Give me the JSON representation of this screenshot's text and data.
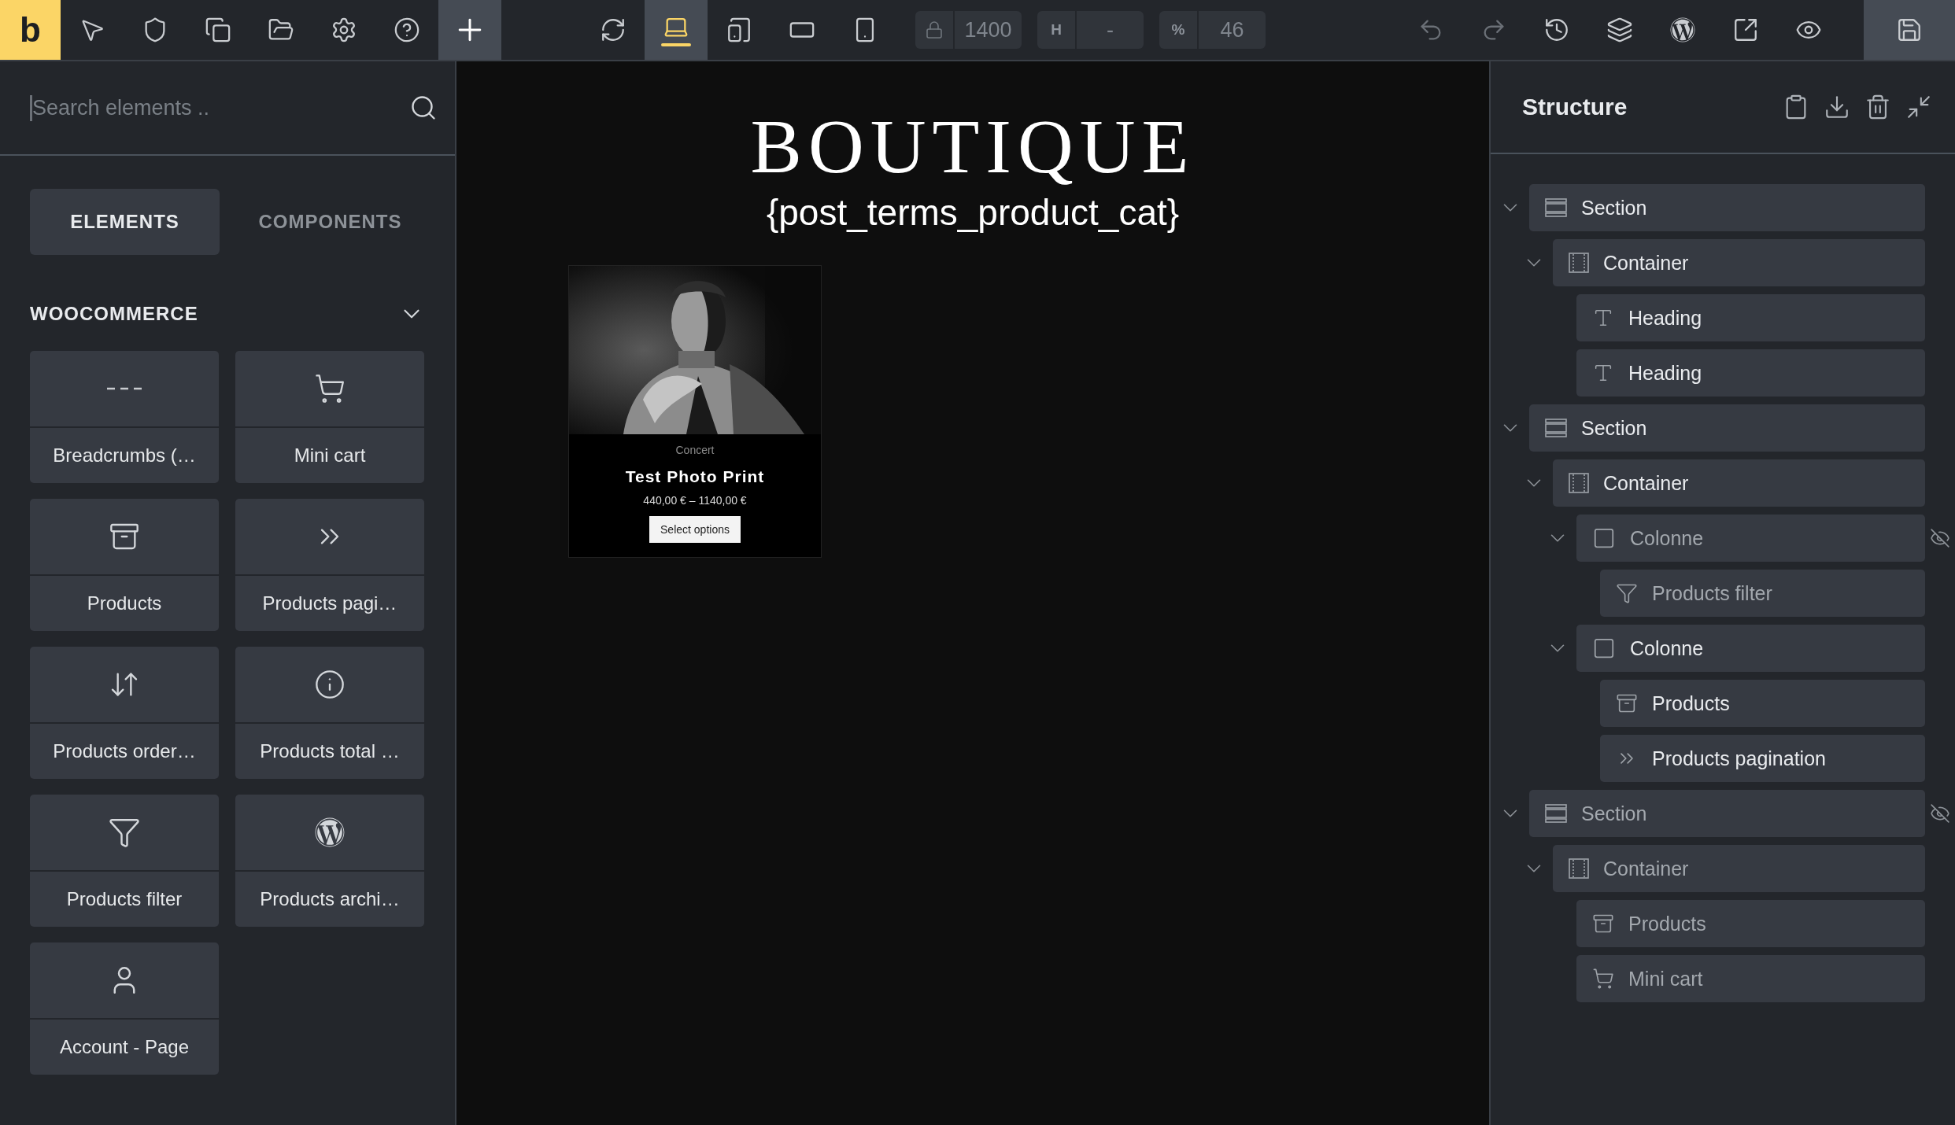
{
  "toolbar": {
    "logo": "b",
    "left_tools": [
      {
        "kind": "pointer",
        "active": false
      },
      {
        "kind": "css",
        "active": false
      },
      {
        "kind": "pages",
        "active": false
      },
      {
        "kind": "folder",
        "active": false
      },
      {
        "kind": "settings",
        "active": false
      },
      {
        "kind": "help",
        "active": false
      },
      {
        "kind": "add",
        "active": true
      }
    ],
    "devices": [
      {
        "kind": "rotate",
        "selected": false
      },
      {
        "kind": "laptop",
        "selected": true
      },
      {
        "kind": "tablet-touch",
        "selected": false
      },
      {
        "kind": "tablet",
        "selected": false
      },
      {
        "kind": "phone",
        "selected": false
      }
    ],
    "size_fields": [
      {
        "kind": "lock",
        "value": "1400"
      },
      {
        "kind": "label",
        "label": "H",
        "value": "-"
      },
      {
        "kind": "label",
        "label": "%",
        "value": "46"
      }
    ],
    "right_tools": [
      {
        "kind": "undo",
        "disabled": true
      },
      {
        "kind": "redo",
        "disabled": true
      },
      {
        "kind": "history",
        "disabled": false
      },
      {
        "kind": "layers",
        "disabled": false
      },
      {
        "kind": "wordpress",
        "disabled": false
      },
      {
        "kind": "external",
        "disabled": false
      },
      {
        "kind": "preview",
        "disabled": false
      },
      {
        "kind": "save",
        "disabled": false
      }
    ]
  },
  "sidebar": {
    "search": {
      "placeholder": "Search elements .."
    },
    "tabs": [
      {
        "label": "ELEMENTS",
        "selected": true
      },
      {
        "label": "COMPONENTS",
        "selected": false
      }
    ],
    "category": {
      "title": "WOOCOMMERCE",
      "expanded": true
    },
    "elements": [
      {
        "label": "Breadcrumbs (…",
        "kind": "breadcrumbs"
      },
      {
        "label": "Mini cart",
        "kind": "cart"
      },
      {
        "label": "Products",
        "kind": "products"
      },
      {
        "label": "Products pagi…",
        "kind": "pagination"
      },
      {
        "label": "Products order…",
        "kind": "order"
      },
      {
        "label": "Products total …",
        "kind": "total"
      },
      {
        "label": "Products filter",
        "kind": "filter"
      },
      {
        "label": "Products archi…",
        "kind": "wordpress"
      },
      {
        "label": "Account - Page",
        "kind": "account"
      }
    ]
  },
  "canvas": {
    "title": "BOUTIQUE",
    "subtitle": "{post_terms_product_cat}",
    "product": {
      "category": "Concert",
      "name": "Test Photo Print",
      "price": "440,00 € – 1140,00 €",
      "button": "Select options"
    }
  },
  "structure": {
    "title": "Structure",
    "actions": [
      {
        "kind": "clipboard"
      },
      {
        "kind": "download"
      },
      {
        "kind": "trash"
      },
      {
        "kind": "collapse"
      }
    ],
    "items": [
      {
        "label": "Section",
        "kind": "section",
        "hidden": false,
        "expanded": true,
        "children": [
          {
            "label": "Container",
            "kind": "container",
            "hidden": false,
            "expanded": true,
            "children": [
              {
                "label": "Heading",
                "kind": "heading",
                "hidden": false
              },
              {
                "label": "Heading",
                "kind": "heading",
                "hidden": false
              }
            ]
          }
        ]
      },
      {
        "label": "Section",
        "kind": "section",
        "hidden": false,
        "expanded": true,
        "children": [
          {
            "label": "Container",
            "kind": "container",
            "hidden": false,
            "expanded": true,
            "children": [
              {
                "label": "Colonne",
                "kind": "column",
                "hidden": true,
                "expanded": true,
                "children": [
                  {
                    "label": "Products filter",
                    "kind": "filter",
                    "hidden": false
                  }
                ]
              },
              {
                "label": "Colonne",
                "kind": "column",
                "hidden": false,
                "expanded": true,
                "children": [
                  {
                    "label": "Products",
                    "kind": "products",
                    "hidden": false
                  },
                  {
                    "label": "Products pagination",
                    "kind": "pagination",
                    "hidden": false
                  }
                ]
              }
            ]
          }
        ]
      },
      {
        "label": "Section",
        "kind": "section",
        "hidden": true,
        "expanded": true,
        "children": [
          {
            "label": "Container",
            "kind": "container",
            "hidden": false,
            "expanded": true,
            "children": [
              {
                "label": "Products",
                "kind": "products",
                "hidden": false
              },
              {
                "label": "Mini cart",
                "kind": "cart",
                "hidden": false
              }
            ]
          }
        ]
      }
    ]
  }
}
